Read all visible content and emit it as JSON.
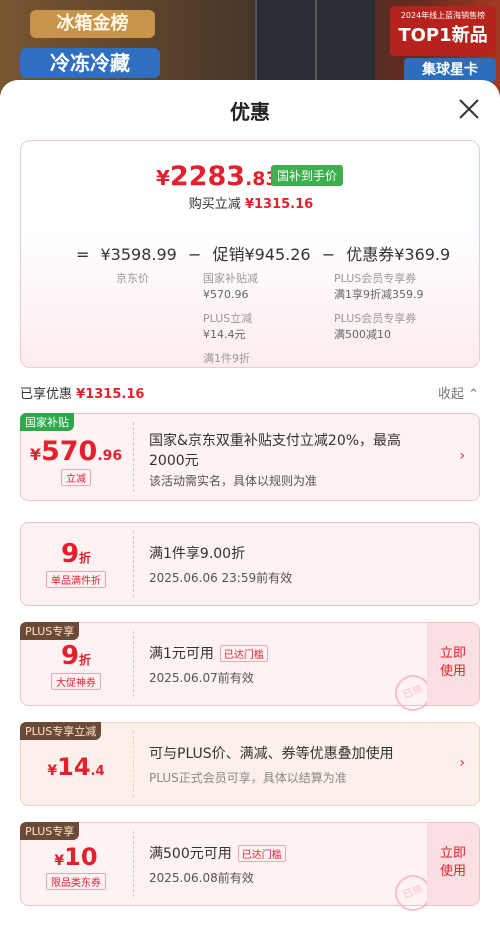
{
  "background": {
    "badge1": "冰箱金榜",
    "badge2": "冷冻冷藏",
    "badge3": "集球星卡",
    "top1_small": "2024年线上蓝海销售榜",
    "top1_large": "TOP1新品"
  },
  "sheet": {
    "title": "优惠",
    "close_icon": "close-icon"
  },
  "summary": {
    "price_symbol": "¥",
    "price_int": "2283",
    "price_dec": ".83",
    "price_tag": "国补到手价",
    "instant_label": "购买立减",
    "instant_value": "¥1315.16",
    "formula": {
      "eq": "=",
      "base": "¥3598.99",
      "minus1": "−",
      "promo": "促销¥945.26",
      "minus2": "−",
      "coupon": "优惠券¥369.9"
    },
    "base_label": "京东价",
    "promo_items": [
      {
        "label": "国家补贴减",
        "value": "¥570.96"
      },
      {
        "label": "PLUS立减",
        "value": "¥14.4元"
      },
      {
        "label": "满1件9折",
        "value": ""
      }
    ],
    "coupon_items": [
      {
        "label": "PLUS会员专享券",
        "value": "满1享9折减359.9"
      },
      {
        "label": "PLUS会员专享券",
        "value": "满500减10"
      }
    ]
  },
  "applied": {
    "label": "已享优惠",
    "value": "¥1315.16",
    "collapse": "收起",
    "collapse_icon": "chevron-up-icon"
  },
  "cards": [
    {
      "tag": "国家补贴",
      "amount_symbol": "¥",
      "amount_int": "570",
      "amount_dec": ".96",
      "sub": "立减",
      "line1": "国家&京东双重补贴支付立减20%，最高",
      "line1b": "2000元",
      "line2": "该活动需实名，具体以规则为准",
      "chevron": "›"
    },
    {
      "amount_int": "9",
      "amount_unit": "折",
      "sub": "单品满件折",
      "line1": "满1件享9.00折",
      "line2": "2025.06.06  23:59前有效"
    },
    {
      "tag": "PLUS专享",
      "amount_int": "9",
      "amount_unit": "折",
      "sub": "大促神券",
      "line1": "满1元可用",
      "reached": "已达门槛",
      "line2": "2025.06.07前有效",
      "use": "立即\n使用",
      "stamp": "已领"
    },
    {
      "tag": "PLUS专享立减",
      "amount_symbol": "¥",
      "amount_int": "14",
      "amount_dec": ".4",
      "line1": "可与PLUS价、满减、券等优惠叠加使用",
      "line2": "PLUS正式会员可享，具体以结算为准",
      "chevron": "›"
    },
    {
      "tag": "PLUS专享",
      "amount_symbol": "¥",
      "amount_int": "10",
      "sub": "限品类东券",
      "line1": "满500元可用",
      "reached": "已达门槛",
      "line2": "2025.06.08前有效",
      "use": "立即\n使用",
      "stamp": "已领"
    }
  ]
}
